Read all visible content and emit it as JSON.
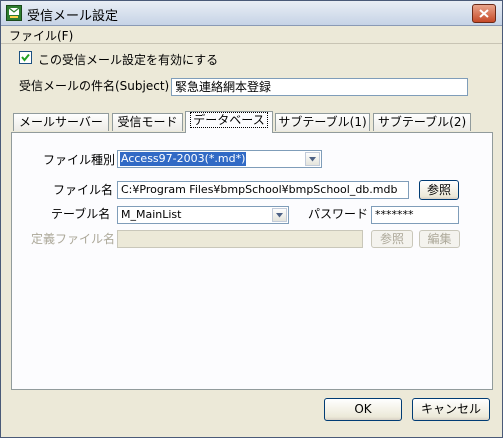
{
  "window": {
    "title": "受信メール設定"
  },
  "menu": {
    "file": "ファイル(F)"
  },
  "general": {
    "enable_label": "この受信メール設定を有効にする",
    "enabled": true,
    "subject_label": "受信メールの件名(Subject)",
    "subject_value": "緊急連絡網本登録"
  },
  "tabs": [
    {
      "label": "メールサーバー"
    },
    {
      "label": "受信モード"
    },
    {
      "label": "データベース",
      "active": true
    },
    {
      "label": "サブテーブル(1)"
    },
    {
      "label": "サブテーブル(2)"
    }
  ],
  "database": {
    "file_type_label": "ファイル種別",
    "file_type_value": "Access97-2003(*.md*)",
    "file_name_label": "ファイル名",
    "file_name_value": "C:¥Program Files¥bmpSchool¥bmpSchool_db.mdb",
    "browse_label": "参照",
    "table_name_label": "テーブル名",
    "table_name_value": "M_MainList",
    "password_label": "パスワード",
    "password_value": "*******",
    "definition_label": "定義ファイル名",
    "definition_value": "",
    "definition_browse_label": "参照",
    "edit_label": "編集"
  },
  "footer": {
    "ok_label": "OK",
    "cancel_label": "キャンセル"
  }
}
